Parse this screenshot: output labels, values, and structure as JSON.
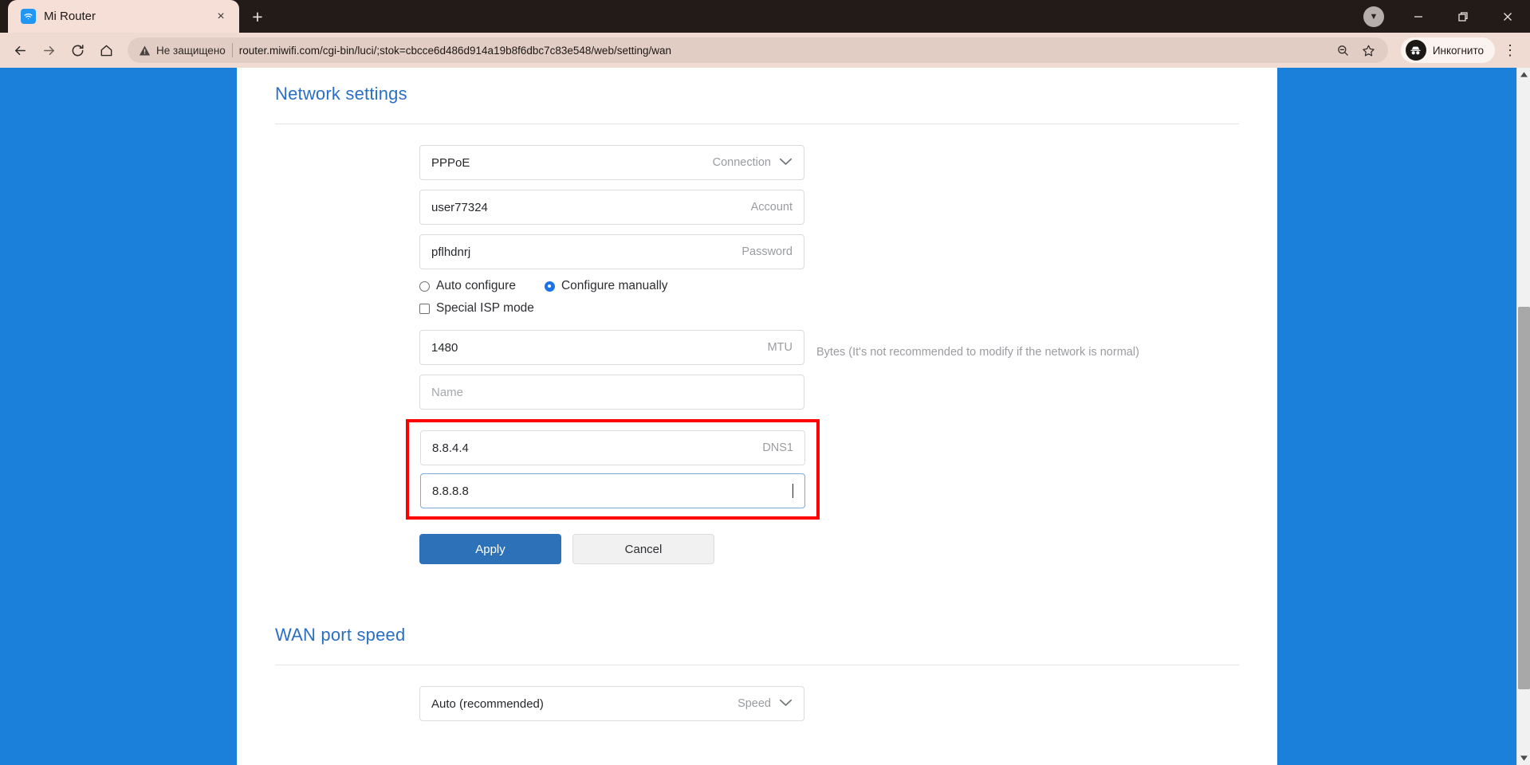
{
  "browser": {
    "tab": {
      "title": "Mi Router",
      "favicon": "wifi-icon",
      "close": "×"
    },
    "new_tab": "+",
    "window_controls": {
      "minimize": "—",
      "maximize": "❐",
      "close": "✕",
      "update": "▼"
    },
    "toolbar": {
      "back": "←",
      "forward": "→",
      "reload": "⟳",
      "home": "⌂",
      "security_warning": "Не защищено",
      "url": "router.miwifi.com/cgi-bin/luci/;stok=cbcce6d486d914a19b8f6dbc7c83e548/web/setting/wan",
      "zoom_out": "zoom-out-icon",
      "bookmark": "☆",
      "profile_label": "Инкогнито",
      "menu": "⋮"
    }
  },
  "page": {
    "background_color": "#1a80da",
    "accent_color": "#2a6fc4",
    "highlight_color": "#ff0000",
    "network_settings": {
      "title": "Network settings",
      "connection": {
        "value": "PPPoE",
        "label": "Connection",
        "chevron": "⌄"
      },
      "account": {
        "value": "user77324",
        "label": "Account"
      },
      "password": {
        "value": "pflhdnrj",
        "label": "Password"
      },
      "config_mode": {
        "auto": {
          "label": "Auto configure",
          "selected": false
        },
        "manual": {
          "label": "Configure manually",
          "selected": true
        }
      },
      "special_isp": {
        "label": "Special ISP mode",
        "checked": false
      },
      "mtu": {
        "value": "1480",
        "label": "MTU",
        "hint": "Bytes (It's not recommended to modify if the network is normal)"
      },
      "name": {
        "value": "",
        "placeholder": "Name"
      },
      "dns1": {
        "value": "8.8.4.4",
        "label": "DNS1"
      },
      "dns2": {
        "value": "8.8.8.8",
        "label": "",
        "focused": true
      },
      "apply_button": "Apply",
      "cancel_button": "Cancel"
    },
    "wan_port_speed": {
      "title": "WAN port speed",
      "speed": {
        "value": "Auto (recommended)",
        "label": "Speed",
        "chevron": "⌄"
      }
    }
  },
  "scrollbar": {
    "up_arrow": "▲",
    "down_arrow": "▼"
  }
}
